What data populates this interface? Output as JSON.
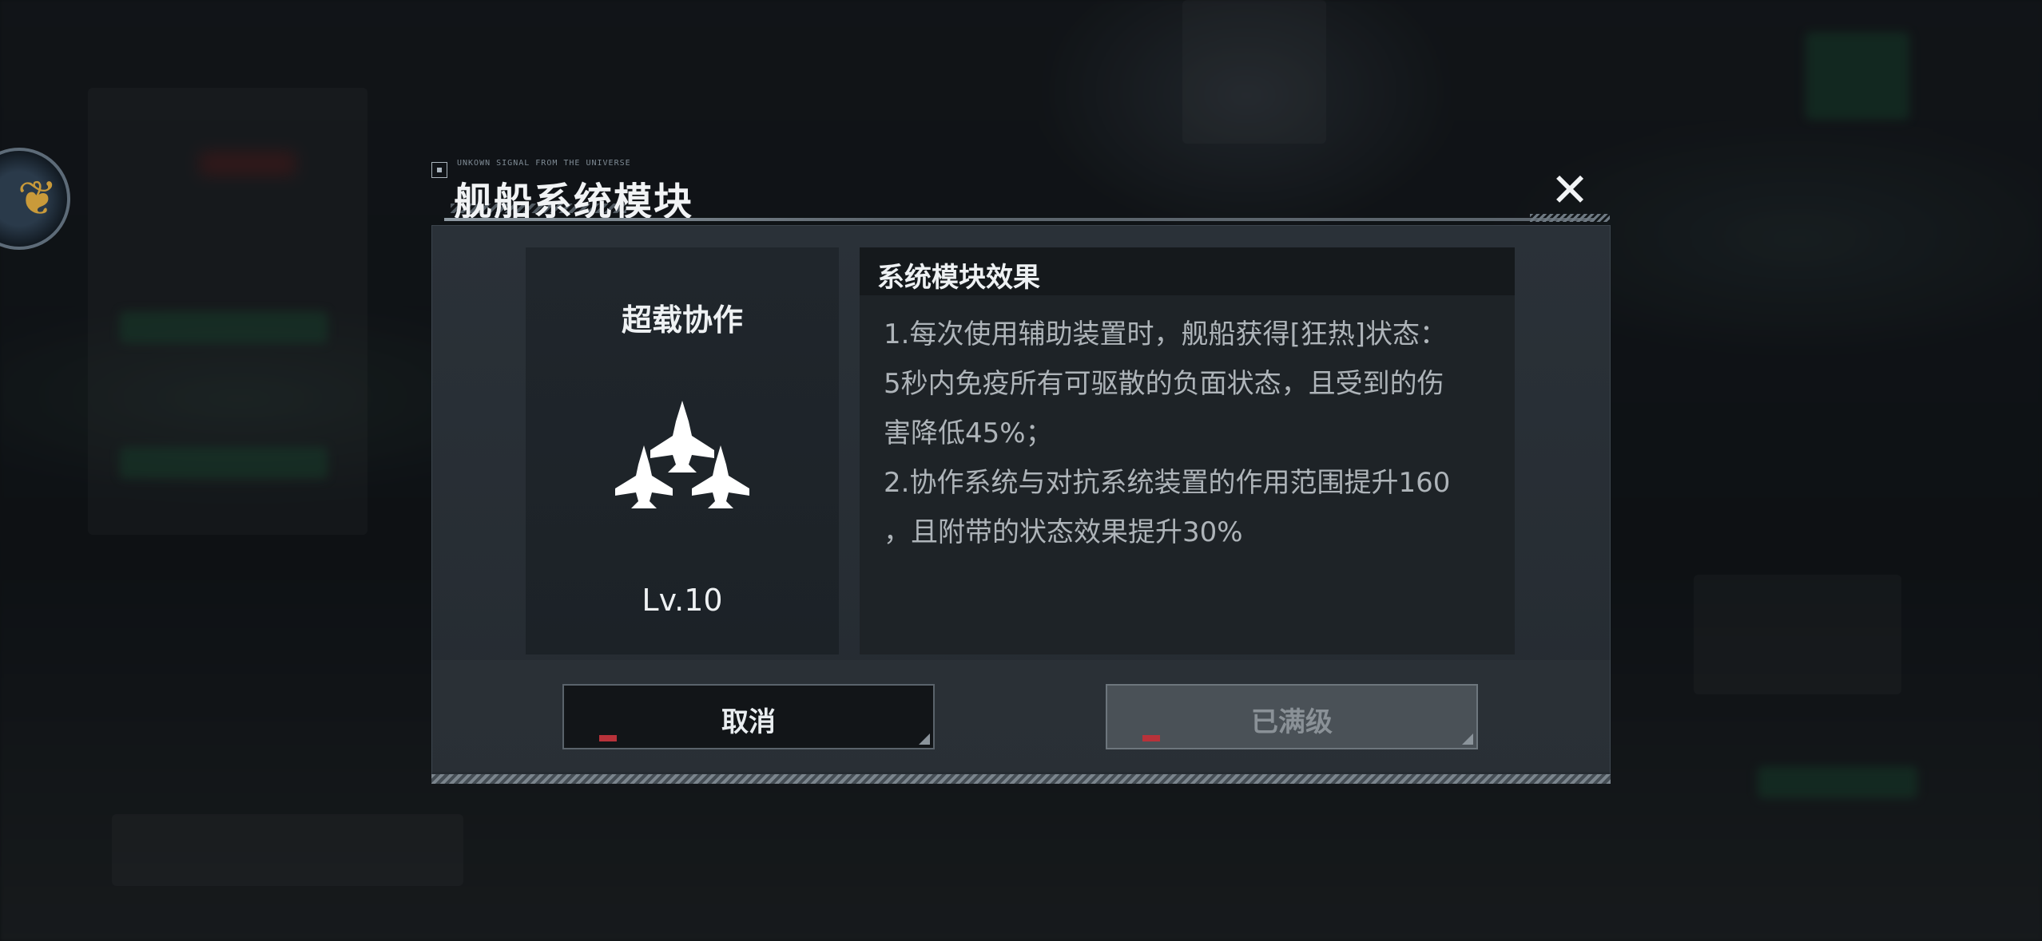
{
  "header": {
    "signal_text": "UNKOWN SIGNAL FROM THE UNIVERSE",
    "title": "舰船系统模块",
    "close_glyph": "✕"
  },
  "module": {
    "name": "超载协作",
    "level": "Lv.10",
    "icon": "three-fighter-jets-icon"
  },
  "effect": {
    "title": "系统模块效果",
    "lines": [
      "1.每次使用辅助装置时，舰船获得[狂热]状态：",
      "5秒内免疫所有可驱散的负面状态，且受到的伤",
      "害降低45%；",
      "2.协作系统与对抗系统装置的作用范围提升160",
      "，且附带的状态效果提升30%"
    ]
  },
  "buttons": {
    "cancel_label": "取消",
    "max_label": "已满级"
  },
  "colors": {
    "panel": "#252b31",
    "text": "#eef1f3",
    "muted_text": "#aeb4b9",
    "disabled_button": "#4a5157"
  }
}
